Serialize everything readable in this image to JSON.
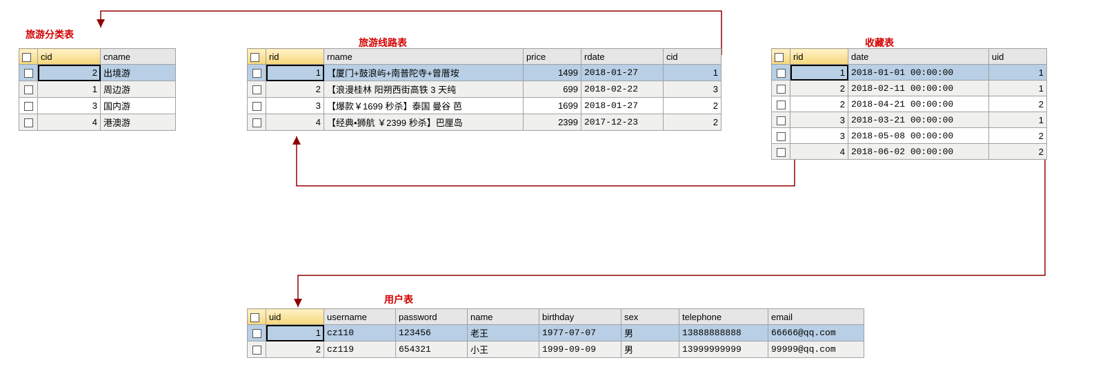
{
  "titles": {
    "category": "旅游分类表",
    "route": "旅游线路表",
    "favorite": "收藏表",
    "user": "用户表"
  },
  "category": {
    "headers": {
      "cid": "cid",
      "cname": "cname"
    },
    "rows": [
      {
        "cid": "2",
        "cname": "出境游",
        "selected": true
      },
      {
        "cid": "1",
        "cname": "周边游"
      },
      {
        "cid": "3",
        "cname": "国内游"
      },
      {
        "cid": "4",
        "cname": "港澳游"
      }
    ]
  },
  "route": {
    "headers": {
      "rid": "rid",
      "rname": "rname",
      "price": "price",
      "rdate": "rdate",
      "cid": "cid"
    },
    "rows": [
      {
        "rid": "1",
        "rname": "【厦门+鼓浪屿+南普陀寺+曾厝垵",
        "price": "1499",
        "rdate": "2018-01-27",
        "cid": "1",
        "selected": true
      },
      {
        "rid": "2",
        "rname": "【浪漫桂林 阳朔西街高铁 3 天纯",
        "price": "699",
        "rdate": "2018-02-22",
        "cid": "3"
      },
      {
        "rid": "3",
        "rname": "【爆款￥1699 秒杀】泰国 曼谷 芭",
        "price": "1699",
        "rdate": "2018-01-27",
        "cid": "2"
      },
      {
        "rid": "4",
        "rname": "【经典•狮航 ￥2399 秒杀】巴厘岛",
        "price": "2399",
        "rdate": "2017-12-23",
        "cid": "2"
      }
    ]
  },
  "favorite": {
    "headers": {
      "rid": "rid",
      "date": "date",
      "uid": "uid"
    },
    "rows": [
      {
        "rid": "1",
        "date": "2018-01-01 00:00:00",
        "uid": "1",
        "selected": true
      },
      {
        "rid": "2",
        "date": "2018-02-11 00:00:00",
        "uid": "1"
      },
      {
        "rid": "2",
        "date": "2018-04-21 00:00:00",
        "uid": "2"
      },
      {
        "rid": "3",
        "date": "2018-03-21 00:00:00",
        "uid": "1"
      },
      {
        "rid": "3",
        "date": "2018-05-08 00:00:00",
        "uid": "2"
      },
      {
        "rid": "4",
        "date": "2018-06-02 00:00:00",
        "uid": "2"
      }
    ]
  },
  "user": {
    "headers": {
      "uid": "uid",
      "username": "username",
      "password": "password",
      "name": "name",
      "birthday": "birthday",
      "sex": "sex",
      "telephone": "telephone",
      "email": "email"
    },
    "rows": [
      {
        "uid": "1",
        "username": "cz110",
        "password": "123456",
        "name": "老王",
        "birthday": "1977-07-07",
        "sex": "男",
        "telephone": "13888888888",
        "email": "66666@qq.com",
        "selected": true
      },
      {
        "uid": "2",
        "username": "cz119",
        "password": "654321",
        "name": "小王",
        "birthday": "1999-09-09",
        "sex": "男",
        "telephone": "13999999999",
        "email": "99999@qq.com"
      }
    ]
  }
}
